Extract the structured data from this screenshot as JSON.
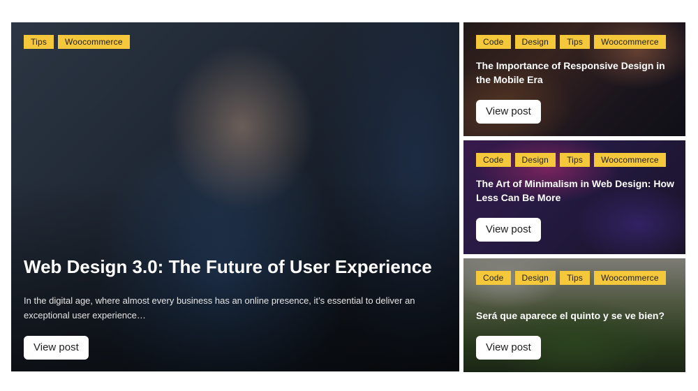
{
  "featured": {
    "tags": [
      "Tips",
      "Woocommerce"
    ],
    "title": "Web Design 3.0: The Future of User Experience",
    "excerpt": "In the digital age, where almost every business has an online presence, it’s essential to deliver an exceptional user experience…",
    "button_label": "View post"
  },
  "posts": [
    {
      "tags": [
        "Code",
        "Design",
        "Tips",
        "Woocommerce"
      ],
      "title": "The Importance of Responsive Design in the Mobile Era",
      "button_label": "View post"
    },
    {
      "tags": [
        "Code",
        "Design",
        "Tips",
        "Woocommerce"
      ],
      "title": "The Art of Minimalism in Web Design: How Less Can Be More",
      "button_label": "View post"
    },
    {
      "tags": [
        "Code",
        "Design",
        "Tips",
        "Woocommerce"
      ],
      "title": "Será que aparece el quinto y se ve bien?",
      "button_label": "View post"
    }
  ],
  "colors": {
    "tag_background": "#f5c83b",
    "tag_text": "#1d1d1d",
    "button_background": "#ffffff"
  }
}
